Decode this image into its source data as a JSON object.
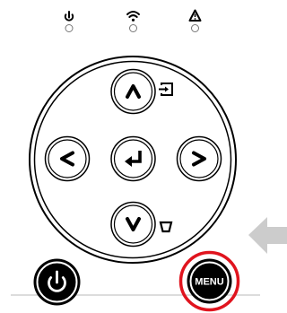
{
  "indicators": [
    {
      "name": "power",
      "icon": "power-icon",
      "state": "off"
    },
    {
      "name": "wifi",
      "icon": "wifi-icon",
      "state": "off"
    },
    {
      "name": "warning",
      "icon": "warning-icon",
      "state": "off"
    }
  ],
  "dpad": {
    "up": {
      "icon": "chevron-up-icon",
      "side_icon": "input-source-icon"
    },
    "left": {
      "icon": "chevron-left-icon"
    },
    "center": {
      "icon": "enter-icon"
    },
    "right": {
      "icon": "chevron-right-icon"
    },
    "down": {
      "icon": "chevron-down-icon",
      "side_icon": "keystone-icon"
    }
  },
  "buttons": {
    "power": {
      "icon": "power-icon"
    },
    "menu": {
      "label": "MENU",
      "highlight_color": "#e0141e"
    }
  },
  "callout": {
    "icon": "arrow-left-icon",
    "color": "#cccccc"
  }
}
